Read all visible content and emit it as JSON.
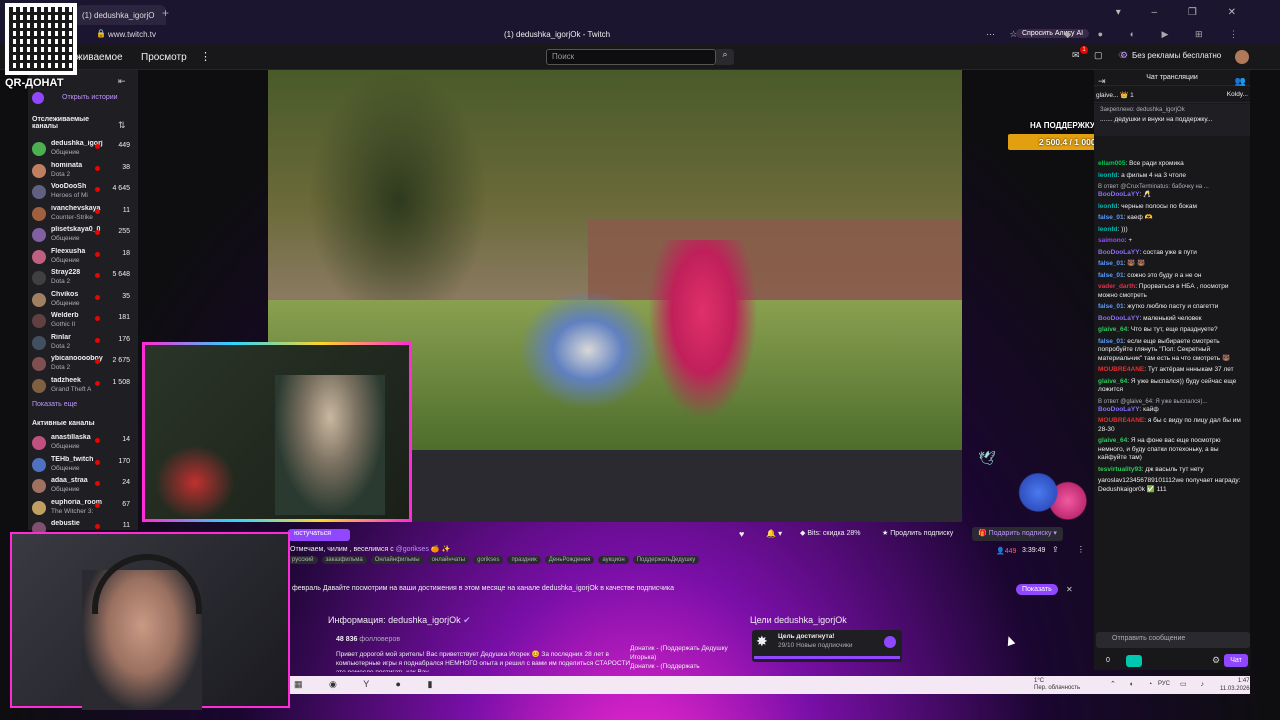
{
  "browser": {
    "tab_title": "(1) dedushka_igorjOk - Twitch",
    "tab_short": "(1) dedushka_igorjO",
    "url": "www.twitch.tv",
    "page_title": "(1) dedushka_igorjOk - Twitch",
    "alisa_label": "Спросить Алису AI"
  },
  "overlay": {
    "qr_label": "QR-ДОНАТ"
  },
  "topnav": {
    "following": "живаемое",
    "browse": "Просмотр",
    "more": "⋮",
    "search_placeholder": "Поиск",
    "notif_count": "1",
    "no_ads": "Без рекламы бесплатно"
  },
  "sidebar": {
    "history": "Открыть истории",
    "followed_heading": "Отслеживаемые каналы",
    "followed": [
      {
        "name": "dedushka_igorj",
        "game": "Общение",
        "viewers": "449",
        "color": "#4caf50"
      },
      {
        "name": "hominata",
        "game": "Dota 2",
        "viewers": "38",
        "color": "#c08060"
      },
      {
        "name": "VooDooSh",
        "game": "Heroes of Mi",
        "viewers": "4 645",
        "color": "#606080"
      },
      {
        "name": "ivanchevskaya",
        "game": "Counter-Strike",
        "viewers": "11",
        "color": "#a06040"
      },
      {
        "name": "plisetskaya0_0",
        "game": "Общение",
        "viewers": "255",
        "color": "#8060a0"
      },
      {
        "name": "Fleexusha",
        "game": "Общение",
        "viewers": "18",
        "color": "#c06080"
      },
      {
        "name": "Stray228",
        "game": "Dota 2",
        "viewers": "5 648",
        "color": "#404040"
      },
      {
        "name": "Chvikos",
        "game": "Общение",
        "viewers": "35",
        "color": "#a08060"
      },
      {
        "name": "Welderb",
        "game": "Gothic II",
        "viewers": "181",
        "color": "#604040"
      },
      {
        "name": "Rinlar",
        "game": "Dota 2",
        "viewers": "176",
        "color": "#405060"
      },
      {
        "name": "ybicanooooboy",
        "game": "Dota 2",
        "viewers": "2 675",
        "color": "#805050"
      },
      {
        "name": "tadzheek",
        "game": "Grand Theft A",
        "viewers": "1 508",
        "color": "#806040"
      }
    ],
    "show_more": "Показать еще",
    "active_heading": "Активные каналы",
    "active": [
      {
        "name": "anastillaska",
        "game": "Общение",
        "viewers": "14",
        "color": "#c05080"
      },
      {
        "name": "TEHb_twitch",
        "game": "Общение",
        "viewers": "170",
        "color": "#5070c0"
      },
      {
        "name": "adaa_straa",
        "game": "Общение",
        "viewers": "24",
        "color": "#a07060"
      },
      {
        "name": "euphoria_room",
        "game": "The Witcher 3:",
        "viewers": "67",
        "color": "#c0a060"
      },
      {
        "name": "debustie",
        "game": "",
        "viewers": "11",
        "color": "#805070"
      }
    ]
  },
  "video": {
    "goal_title": "НА ПОДДЕРЖКУ И РАЗВИТИЕ КАНАЛА",
    "goal_amount": "2 500.4 / 1 000 000 RUB (1%)",
    "goal_progress_pct": 1
  },
  "stream": {
    "follow_label": "Отслеживать",
    "subscribe_left": "юстучаться",
    "title_prefix": "Отмечаем, чилим , веселимся с",
    "title_mention": "@gorikses",
    "title_emoji": "🍊 ✨",
    "tags": [
      "русский",
      "заказфильма",
      "Онлайнфильмы",
      "онлайнчаты",
      "gorikses",
      "праздник",
      "ДеньРождения",
      "аукцион",
      "ПоддержатьДедушку"
    ],
    "bits_label": "Bits: скидка 28%",
    "extend_label": "Продлить подписку",
    "gift_label": "Подарить подписку",
    "viewers": "449",
    "uptime": "3:39:49"
  },
  "promo": {
    "text": "февраль  Давайте посмотрим на ваши достижения в этом месяце на канале dedushka_igorjOk в качестве подписчика",
    "button": "Показать"
  },
  "about": {
    "title": "Информация: dedushka_igorjOk",
    "followers_count": "48 836",
    "followers_label": "фолловеров",
    "text": "Привет дорогой мой зритель! Вас приветствует Дедушка Игорек 😊 За последних 28 лет в компьютерные игры я поднабрался НЕМНОГО опыта и решил с вами им поделиться СТАРОСТИ это ремесло постигать как Вау",
    "donat1": "Донатик - (Поддержать Дедушку Игорька)",
    "donat2": "Донатик - (Поддержать"
  },
  "goals": {
    "title": "Цели dedushka_igorjOk",
    "card_title": "Цель достигнута!",
    "card_sub": "29/10 Новые подписчики"
  },
  "chat": {
    "title": "Чат трансляции",
    "hype_left": "glaive... 👑 1",
    "hype_right": "Koldy...",
    "pinned_label": "Закреплено: dedushka_igorjOk",
    "pinned_text": "....... дедушки и внуки на поддержку...",
    "messages": [
      {
        "type": "msg",
        "user": "ellam005",
        "color": "#00c853",
        "text": "Все ради хромика"
      },
      {
        "type": "msg",
        "user": "leonfd",
        "color": "#00b5ad",
        "text": "а фильм 4 на 3 чтоле"
      },
      {
        "type": "reply",
        "text": "В ответ @CruxTerminatus: бабочку на ..."
      },
      {
        "type": "msg",
        "user": "BooDooLaYY",
        "color": "#8a6cff",
        "text": "🥂"
      },
      {
        "type": "msg",
        "user": "leonfd",
        "color": "#00b5ad",
        "text": "черные полосы по бокам"
      },
      {
        "type": "msg",
        "user": "false_01",
        "color": "#5a9cff",
        "text": "каеф 🫶"
      },
      {
        "type": "msg",
        "user": "leonfd",
        "color": "#00b5ad",
        "text": ")))"
      },
      {
        "type": "msg",
        "user": "saimono",
        "color": "#9147ff",
        "text": "+"
      },
      {
        "type": "msg",
        "user": "BooDooLaYY",
        "color": "#8a6cff",
        "text": "состав уже в пути"
      },
      {
        "type": "msg",
        "user": "false_01",
        "color": "#5a9cff",
        "text": "🐻 🐻"
      },
      {
        "type": "msg",
        "user": "false_01",
        "color": "#5a9cff",
        "text": "сожно это буду я а не он"
      },
      {
        "type": "msg",
        "user": "vader_darth",
        "color": "#e0304a",
        "text": "Прорваться в НБА , посмотри можно смотреть"
      },
      {
        "type": "msg",
        "user": "false_01",
        "color": "#5a9cff",
        "text": "жутко люблю пасту и спагетти"
      },
      {
        "type": "msg",
        "user": "BooDooLaYY",
        "color": "#8a6cff",
        "text": "маленький человек"
      },
      {
        "type": "msg",
        "user": "glaive_64",
        "color": "#2ec95c",
        "text": "Что вы тут, еще празднуете?"
      },
      {
        "type": "msg",
        "user": "false_01",
        "color": "#5a9cff",
        "text": "если еще выбираете смотреть попробуйте глянуть \"Пол: Секретный материальчик\" там есть на что смотреть 🐻"
      },
      {
        "type": "msg",
        "user": "MOUBRE4ANE",
        "color": "#e03030",
        "text": "Тут актёрам ннныкам 37 лет"
      },
      {
        "type": "msg",
        "user": "glaive_64",
        "color": "#2ec95c",
        "text": "Я уже выспался)) буду сейчас еще ложится"
      },
      {
        "type": "reply",
        "text": "В ответ @glaive_64: Я уже выспался)..."
      },
      {
        "type": "msg",
        "user": "BooDooLaYY",
        "color": "#8a6cff",
        "text": "кайф"
      },
      {
        "type": "msg",
        "user": "MOUBRE4ANE",
        "color": "#e03030",
        "text": "я бы с виду по лицу дал бы им 28-30"
      },
      {
        "type": "msg",
        "user": "glaive_64",
        "color": "#2ec95c",
        "text": "Я на фоне вас еще посмотрю немного, и буду спатки потехоньку, а вы кайфуйте там)"
      },
      {
        "type": "msg",
        "user": "tesvirtuality93",
        "color": "#2ec95c",
        "text": "дж васыль тут нету"
      },
      {
        "type": "msg",
        "user": "",
        "color": "#efeff1",
        "text": "yaroslav123456789101112we получает награду: Dedushkaigor0k ✅ 111"
      }
    ],
    "input_placeholder": "Отправить сообщение",
    "points": "0",
    "chat_button": "Чат"
  },
  "taskbar": {
    "weather_temp": "1°C",
    "weather_desc": "Пер. облачность",
    "lang": "РУС",
    "time": "1:47",
    "date": "11.03.2026"
  }
}
